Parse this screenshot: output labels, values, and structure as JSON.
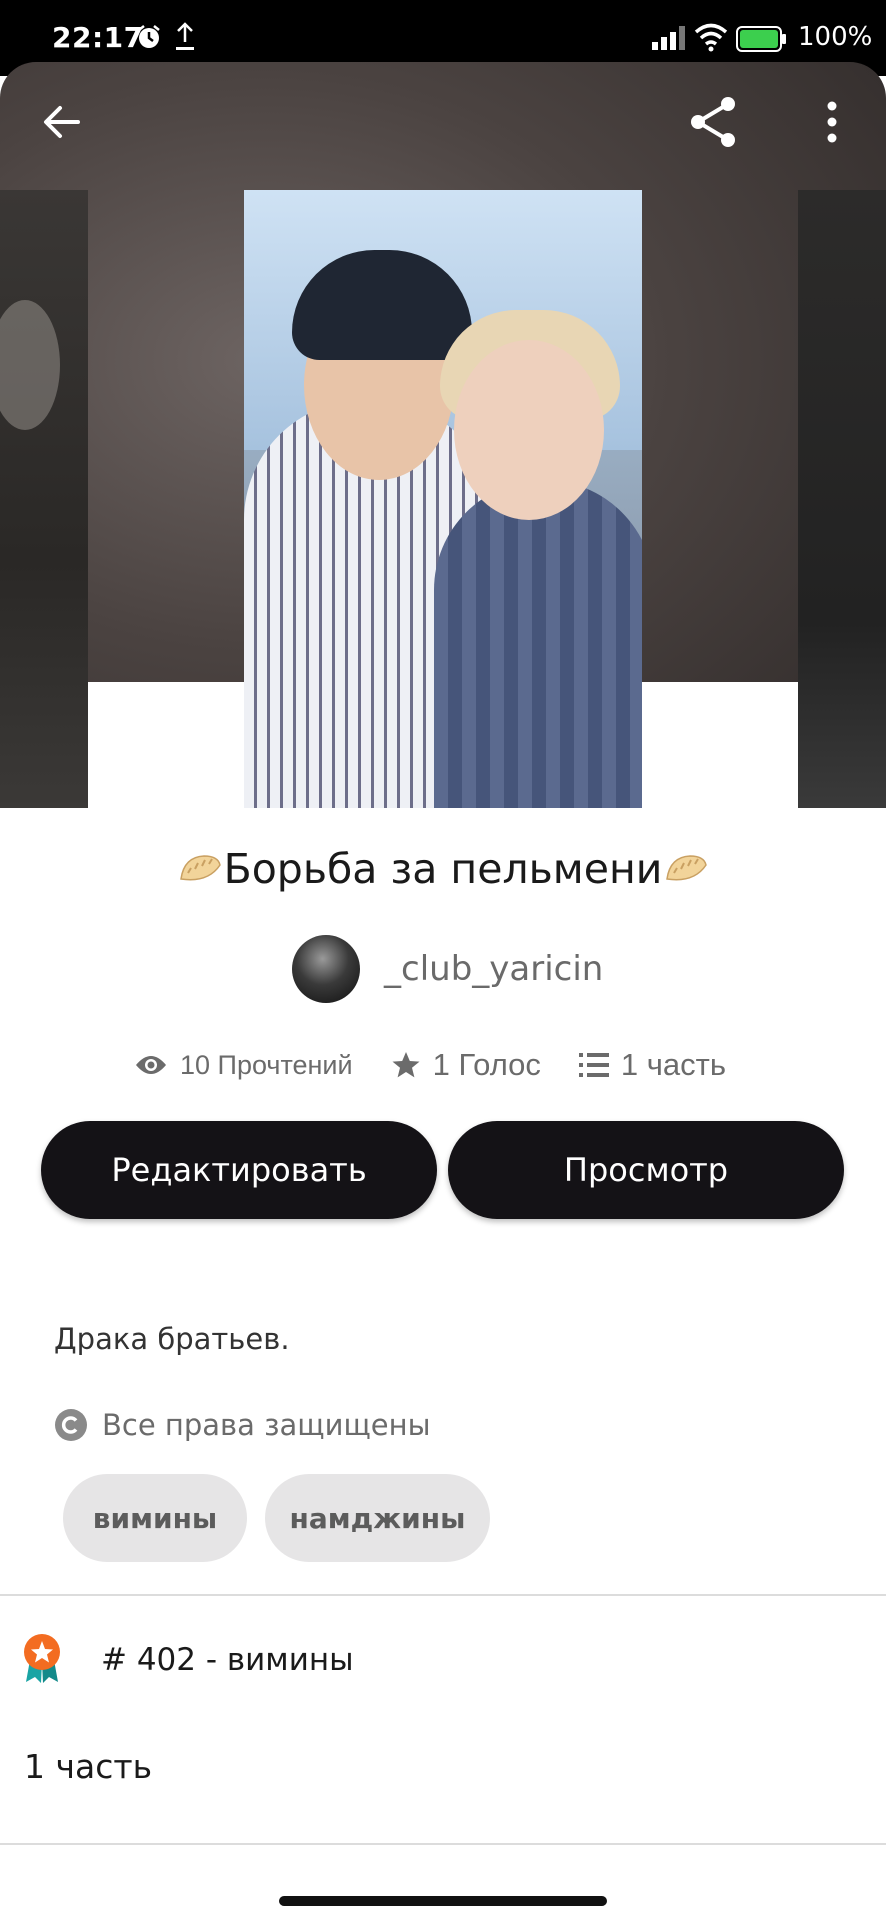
{
  "status_bar": {
    "time": "22:17",
    "battery_percent": "100%"
  },
  "icons": {
    "back": "arrow-left-icon",
    "share": "share-icon",
    "more": "more-vertical-icon",
    "reads": "eye-icon",
    "votes": "star-icon",
    "parts": "list-icon",
    "rights": "copyright-icon",
    "rank": "rank-badge-icon"
  },
  "story": {
    "title": "Борьба за пельмени",
    "author": "_club_yaricin",
    "stats": {
      "reads": "10 Прочтений",
      "votes": "1 Голос",
      "parts": "1 часть"
    },
    "description": "Драка братьев.",
    "rights": "Все права защищены",
    "tags": [
      "вимины",
      "намджины"
    ]
  },
  "actions": {
    "edit_label": "Редактировать",
    "view_label": "Просмотр"
  },
  "ranking": {
    "label": "# 402 - вимины"
  },
  "parts_section": {
    "label": "1 часть"
  },
  "colors": {
    "button_bg": "#141216",
    "tag_bg": "#e6e5e6",
    "rank_badge": "#f36c21",
    "rank_ribbon": "#1aa4a4"
  }
}
